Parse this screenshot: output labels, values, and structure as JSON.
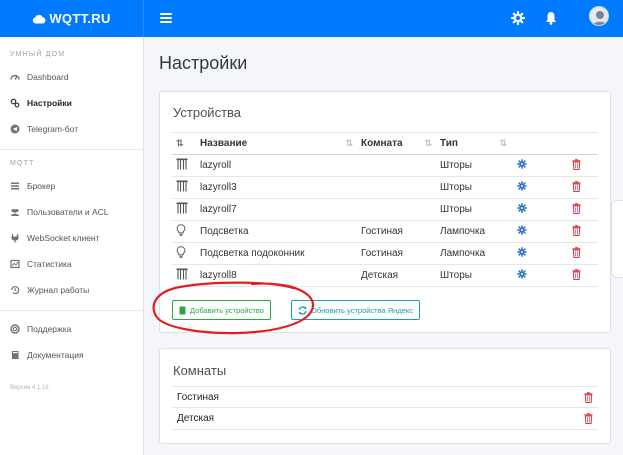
{
  "brand": {
    "name": "WQTT.RU"
  },
  "sidebar": {
    "section_home": "УМНЫЙ ДОМ",
    "items_home": [
      {
        "label": "Dashboard",
        "icon": "dashboard-icon"
      },
      {
        "label": "Настройки",
        "icon": "settings-icon",
        "active": true
      },
      {
        "label": "Telegram-бот",
        "icon": "telegram-icon"
      }
    ],
    "section_mqtt": "MQTT",
    "items_mqtt": [
      {
        "label": "Брокер",
        "icon": "server-icon"
      },
      {
        "label": "Пользователи и ACL",
        "icon": "users-icon"
      },
      {
        "label": "WebSocket клиент",
        "icon": "plug-icon"
      },
      {
        "label": "Статистика",
        "icon": "stats-icon"
      },
      {
        "label": "Журнал работы",
        "icon": "history-icon"
      }
    ],
    "items_help": [
      {
        "label": "Поддержка",
        "icon": "support-icon"
      },
      {
        "label": "Документация",
        "icon": "book-icon"
      }
    ],
    "version": "Версия 4.1.16"
  },
  "page": {
    "title": "Настройки"
  },
  "devices": {
    "title": "Устройства",
    "columns": [
      "Название",
      "Комната",
      "Тип"
    ],
    "rows": [
      {
        "name": "lazyroll",
        "room": "",
        "type": "Шторы",
        "icon": "blinds-icon"
      },
      {
        "name": "lazyroll3",
        "room": "",
        "type": "Шторы",
        "icon": "blinds-icon"
      },
      {
        "name": "lazyroll7",
        "room": "",
        "type": "Шторы",
        "icon": "blinds-icon"
      },
      {
        "name": "Подсветка",
        "room": "Гостиная",
        "type": "Лампочка",
        "icon": "bulb-icon"
      },
      {
        "name": "Подсветка подоконник",
        "room": "Гостиная",
        "type": "Лампочка",
        "icon": "bulb-icon"
      },
      {
        "name": "lazyroll8",
        "room": "Детская",
        "type": "Шторы",
        "icon": "blinds-icon"
      }
    ],
    "add_button": "Добавить устройство",
    "sync_button": "Обновить устройства Яндекс"
  },
  "rooms": {
    "title": "Комнаты",
    "rows": [
      "Гостиная",
      "Детская"
    ]
  },
  "colors": {
    "primary": "#007bff",
    "success": "#28a745",
    "info": "#17a2b8",
    "danger": "#dc3545",
    "annotation": "#e02020"
  }
}
